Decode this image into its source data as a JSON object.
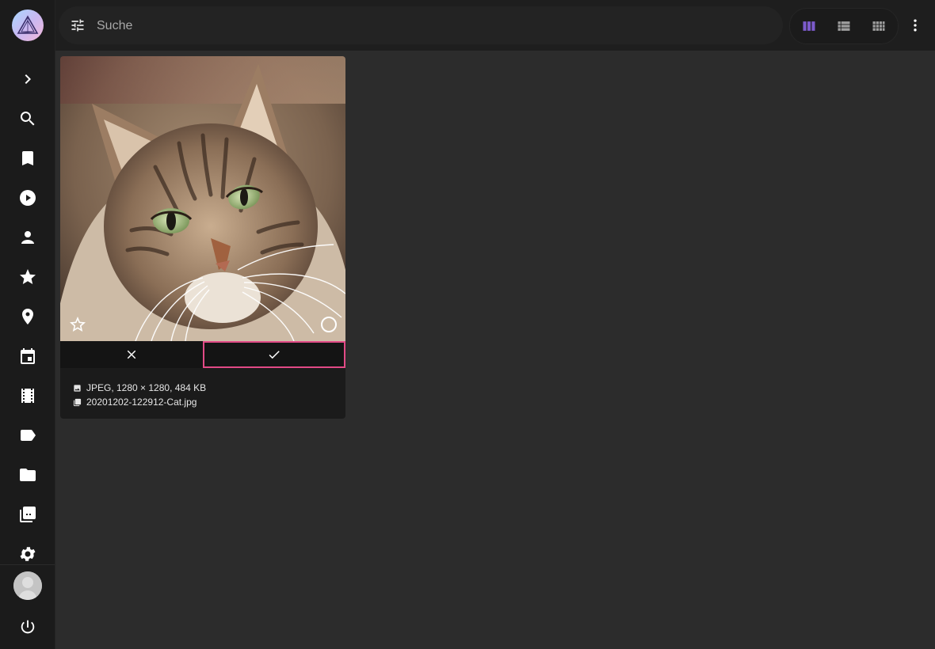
{
  "app": {
    "name": "PhotoPrism"
  },
  "sidebar": {
    "items": [
      {
        "name": "expand",
        "icon": "chevron-right-icon"
      },
      {
        "name": "search",
        "icon": "search-icon"
      },
      {
        "name": "albums",
        "icon": "bookmark-icon"
      },
      {
        "name": "videos",
        "icon": "play-circle-icon"
      },
      {
        "name": "people",
        "icon": "person-icon"
      },
      {
        "name": "favorites",
        "icon": "star-icon"
      },
      {
        "name": "places",
        "icon": "place-icon"
      },
      {
        "name": "calendar",
        "icon": "calendar-icon"
      },
      {
        "name": "moments",
        "icon": "film-icon"
      },
      {
        "name": "labels",
        "icon": "label-icon"
      },
      {
        "name": "folders",
        "icon": "folder-icon"
      },
      {
        "name": "library",
        "icon": "library-icon"
      },
      {
        "name": "settings",
        "icon": "gear-icon"
      }
    ],
    "avatar": "avatar",
    "logout": "power-icon"
  },
  "toolbar": {
    "search_placeholder": "Suche",
    "views": [
      {
        "name": "cards",
        "icon": "view-column-icon",
        "active": true
      },
      {
        "name": "list",
        "icon": "view-list-icon",
        "active": false
      },
      {
        "name": "mosaic",
        "icon": "view-comfy-icon",
        "active": false
      }
    ],
    "more": "more-vertical-icon"
  },
  "card": {
    "image_subject": "Cat",
    "favorite": false,
    "selected": false,
    "info": "JPEG, 1280 × 1280, 484 KB",
    "filename": "20201202-122912-Cat.jpg"
  },
  "colors": {
    "accent": "#7c5bcb",
    "approve_border": "#e24a86",
    "background": "#2c2c2c",
    "sidebar": "#1b1b1b"
  }
}
